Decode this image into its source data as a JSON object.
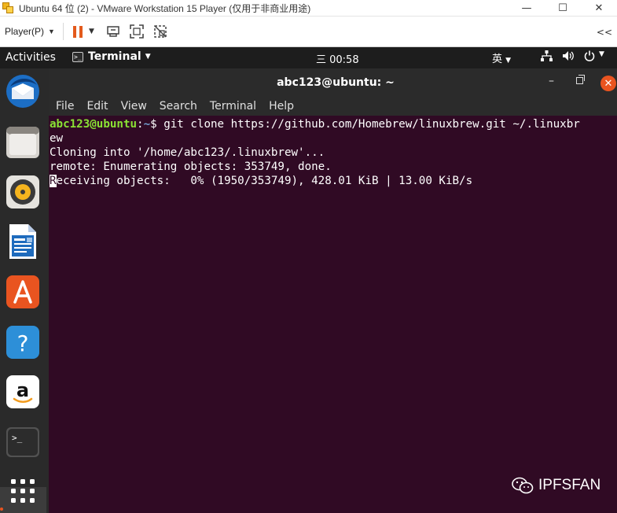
{
  "vm_window": {
    "title": "Ubuntu 64 位 (2) - VMware Workstation 15 Player (仅用于非商业用途)",
    "controls": {
      "minimize": "—",
      "maximize": "☐",
      "close": "✕"
    }
  },
  "vm_toolbar": {
    "player_menu": "Player(P)",
    "collapse": "<<"
  },
  "topbar": {
    "activities": "Activities",
    "app_menu": "Terminal",
    "clock": "三 00:58",
    "input_method": "英"
  },
  "dock": {
    "items": [
      "Thunderbird Mail",
      "Files",
      "Rhythmbox",
      "LibreOffice Writer",
      "Ubuntu Software",
      "Help",
      "Amazon",
      "Terminal",
      "Show Applications"
    ]
  },
  "terminal": {
    "title": "abc123@ubuntu: ~",
    "menu": [
      "File",
      "Edit",
      "View",
      "Search",
      "Terminal",
      "Help"
    ],
    "prompt_user": "abc123@ubuntu",
    "prompt_sep": ":",
    "prompt_path": "~",
    "prompt_symbol": "$",
    "command": " git clone https://github.com/Homebrew/linuxbrew.git ~/.linuxbr",
    "command_wrap": "ew",
    "output": [
      "Cloning into '/home/abc123/.linuxbrew'...",
      "remote: Enumerating objects: 353749, done."
    ],
    "progress_cursor_char": "R",
    "progress_rest": "eceiving objects:   0% (1950/353749), 428.01 KiB | 13.00 KiB/s"
  },
  "watermark": {
    "text": "IPFSFAN"
  }
}
